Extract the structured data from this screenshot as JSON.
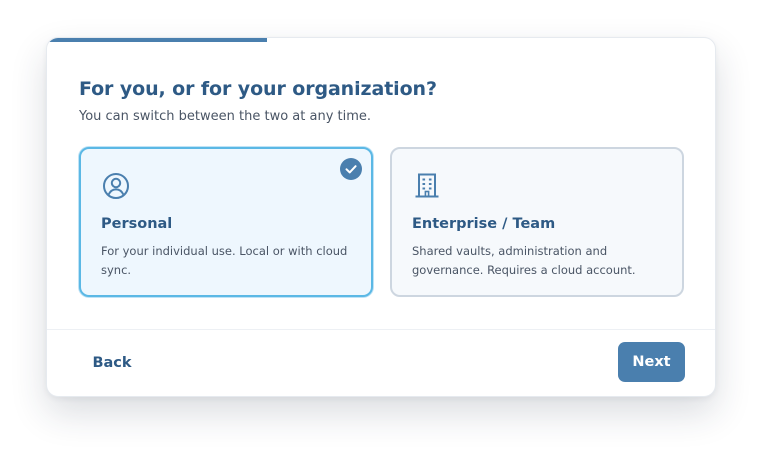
{
  "wizard": {
    "progress_fraction": 0.33,
    "title": "For you, or for your organization?",
    "subtitle": "You can switch between the two at any time.",
    "options": [
      {
        "icon": "user-circle-icon",
        "title": "Personal",
        "description": "For your individual use. Local or with cloud sync.",
        "selected": true
      },
      {
        "icon": "building-icon",
        "title": "Enterprise / Team",
        "description": "Shared vaults, administration and governance. Requires a cloud account.",
        "selected": false
      }
    ],
    "back_label": "Back",
    "next_label": "Next"
  },
  "colors": {
    "accent": "#4a7fae",
    "title_text": "#2e5a85",
    "selected_border": "#5bb8e5",
    "selected_bg": "#eef7fe",
    "unselected_border": "#cdd6e0"
  }
}
